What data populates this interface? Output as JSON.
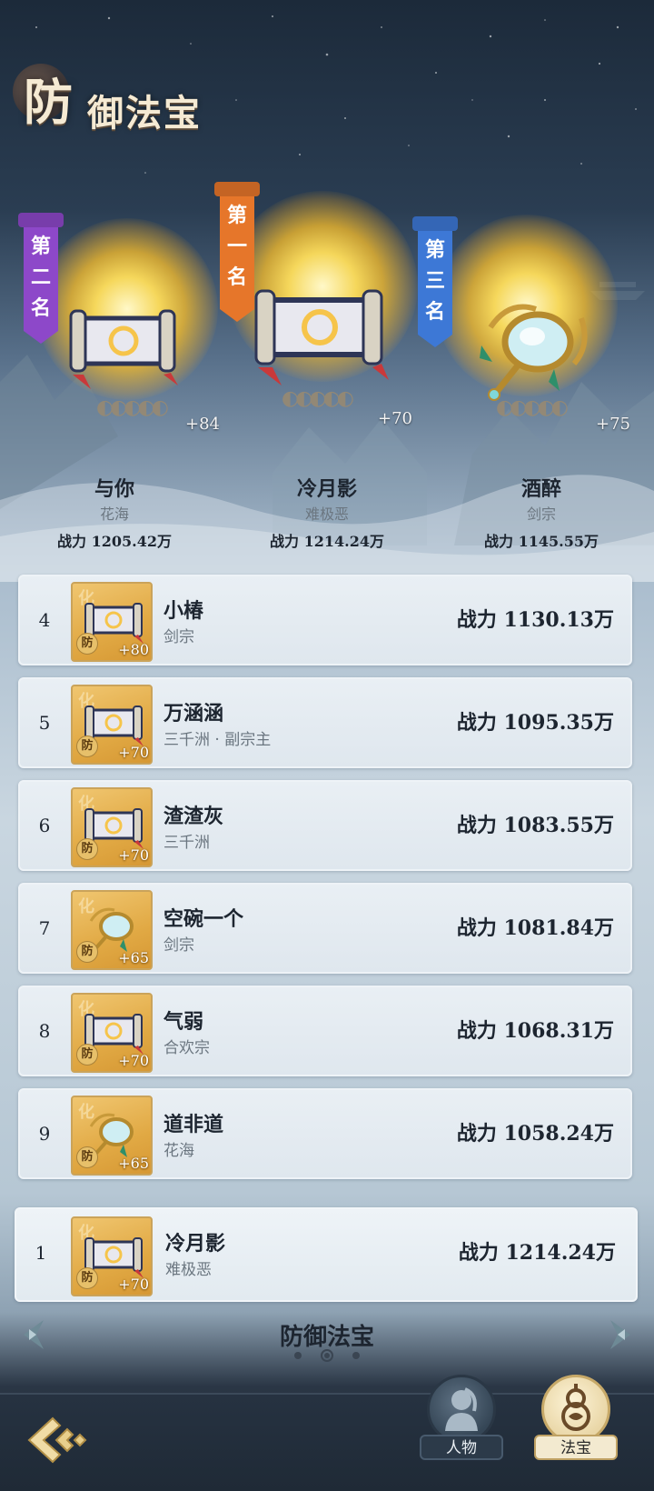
{
  "header": {
    "title_first": "防",
    "title_rest": "御法宝"
  },
  "podium": [
    {
      "place": "second",
      "banner": "第二名",
      "name": "与你",
      "sect": "花海",
      "power": "战力 1205.42万",
      "level": "+84",
      "treasure": "scroll"
    },
    {
      "place": "first",
      "banner": "第一名",
      "name": "冷月影",
      "sect": "难极恶",
      "power": "战力 1214.24万",
      "level": "+70",
      "treasure": "scroll"
    },
    {
      "place": "third",
      "banner": "第三名",
      "name": "酒醉",
      "sect": "剑宗",
      "power": "战力 1145.55万",
      "level": "+75",
      "treasure": "mirror"
    }
  ],
  "icon_badge": {
    "hua": "化",
    "fang": "防"
  },
  "rankings": [
    {
      "rank": "4",
      "name": "小椿",
      "sect": "剑宗",
      "power": "战力 1130.13万",
      "level": "+80",
      "treasure": "scroll"
    },
    {
      "rank": "5",
      "name": "万涵涵",
      "sect": "三千洲 · 副宗主",
      "power": "战力 1095.35万",
      "level": "+70",
      "treasure": "scroll"
    },
    {
      "rank": "6",
      "name": "渣渣灰",
      "sect": "三千洲",
      "power": "战力 1083.55万",
      "level": "+70",
      "treasure": "scroll"
    },
    {
      "rank": "7",
      "name": "空碗一个",
      "sect": "剑宗",
      "power": "战力 1081.84万",
      "level": "+65",
      "treasure": "mirror"
    },
    {
      "rank": "8",
      "name": "气弱",
      "sect": "合欢宗",
      "power": "战力 1068.31万",
      "level": "+70",
      "treasure": "scroll"
    },
    {
      "rank": "9",
      "name": "道非道",
      "sect": "花海",
      "power": "战力 1058.24万",
      "level": "+65",
      "treasure": "mirror"
    }
  ],
  "my_rank": {
    "rank": "1",
    "name": "冷月影",
    "sect": "难极恶",
    "power": "战力 1214.24万",
    "level": "+70",
    "treasure": "scroll"
  },
  "pager": {
    "title": "防御法宝",
    "page_count": 3,
    "active_index": 1
  },
  "tabs": {
    "people": "人物",
    "fabao": "法宝",
    "active": "fabao"
  },
  "icons": {
    "back": "back-arrow-icon",
    "left": "chevron-left-icon",
    "right": "chevron-right-icon",
    "people": "person-icon",
    "fabao": "gourd-icon"
  },
  "colors": {
    "first": "#e6762a",
    "second": "#8d48c9",
    "third": "#3d78d6",
    "gold": "#e1a944"
  }
}
